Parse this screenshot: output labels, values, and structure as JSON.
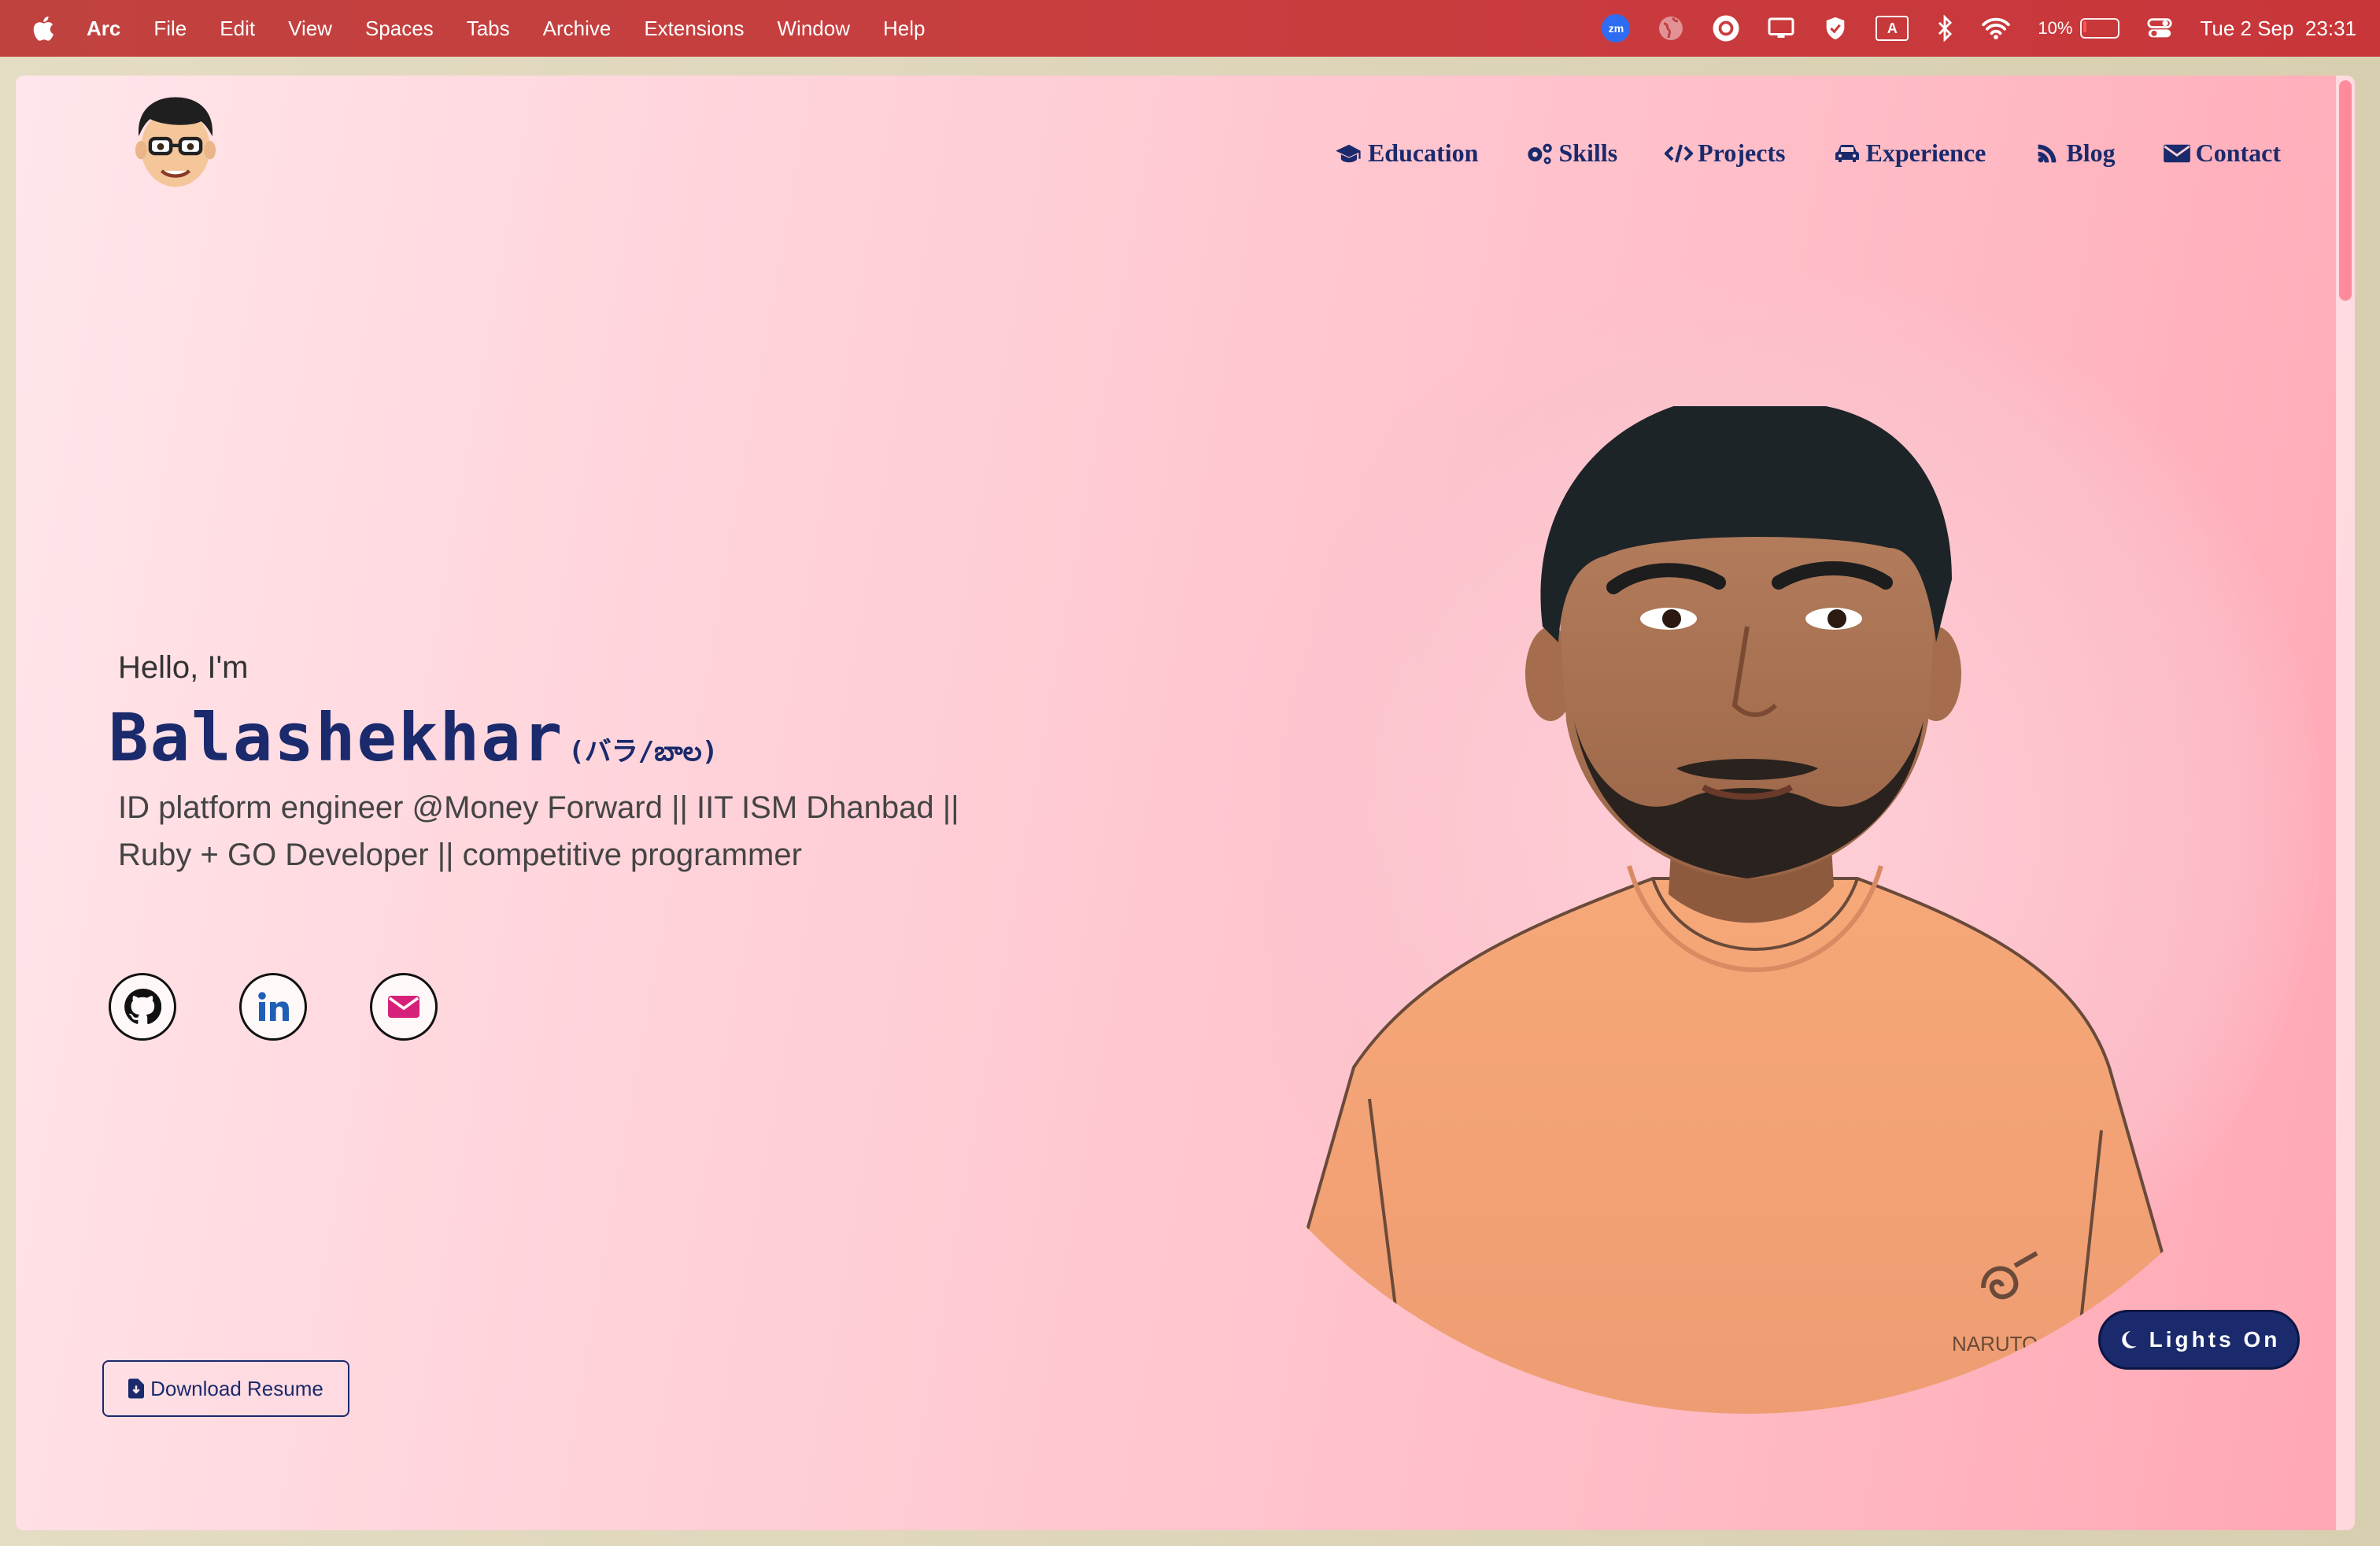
{
  "menubar": {
    "app": "Arc",
    "items": [
      "File",
      "Edit",
      "View",
      "Spaces",
      "Tabs",
      "Archive",
      "Extensions",
      "Window",
      "Help"
    ],
    "status": {
      "zoom_label": "zm",
      "keyboard_label": "A",
      "battery": "10%",
      "battery_level": 0.1,
      "datetime": "Tue 2 Sep  23:31"
    }
  },
  "nav": {
    "education": "Education",
    "skills": "Skills",
    "projects": "Projects",
    "experience": "Experience",
    "blog": "Blog",
    "contact": "Contact"
  },
  "hero": {
    "greeting": "Hello, I'm",
    "name": "Balashekhar",
    "name_alt": "(バラ/బాల)",
    "tagline": "ID platform engineer @Money Forward || IIT ISM Dhanbad || Ruby + GO Developer || competitive programmer",
    "shirt_text": "NARUTO"
  },
  "socials": [
    "github-icon",
    "linkedin-icon",
    "mail-icon"
  ],
  "resume_button": "Download Resume",
  "theme_toggle": "Lights On",
  "colors": {
    "accent": "#1a2a6c",
    "menubar": "#c93d3f",
    "mail": "#d6207a",
    "linkedin": "#1f5fb5"
  }
}
